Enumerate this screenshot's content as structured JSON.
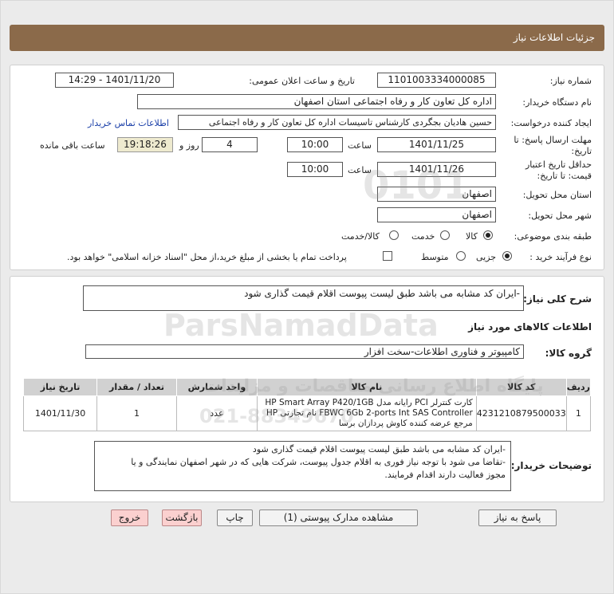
{
  "header": {
    "title": "جزئیات اطلاعات نیاز"
  },
  "form": {
    "need_number_label": "شماره نیاز:",
    "need_number": "1101003334000085",
    "announce_label": "تاریخ و ساعت اعلان عمومی:",
    "announce_value": "1401/11/20 - 14:29",
    "buyer_label": "نام دستگاه خریدار:",
    "buyer_value": "اداره کل تعاون  کار و رفاه اجتماعی استان اصفهان",
    "creator_label": "ایجاد کننده درخواست:",
    "creator_value": "حسین هادیان بجگردی کارشناس تاسیسات اداره کل تعاون  کار و رفاه اجتماعی",
    "contact_link": "اطلاعات تماس خریدار",
    "deadline_label_1": "مهلت ارسال پاسخ: تا",
    "deadline_label_2": "تاریخ:",
    "deadline_date": "1401/11/25",
    "time_label": "ساعت",
    "deadline_time": "10:00",
    "days_value": "4",
    "days_label": "روز و",
    "remaining_time": "19:18:26",
    "remaining_label": "ساعت باقی مانده",
    "validity_label_1": "حداقل تاریخ اعتبار",
    "validity_label_2": "قیمت: تا تاریخ:",
    "validity_date": "1401/11/26",
    "validity_time": "10:00",
    "province_label": "استان محل تحویل:",
    "province_value": "اصفهان",
    "city_label": "شهر محل تحویل:",
    "city_value": "اصفهان",
    "category_label": "طبقه بندی موضوعی:",
    "category_options": [
      "کالا",
      "خدمت",
      "کالا/خدمت"
    ],
    "process_label": "نوع فرآیند خرید :",
    "process_options": [
      "جزیی",
      "متوسط"
    ],
    "payment_note": "پرداخت تمام یا بخشی از مبلغ خرید،از محل \"اسناد خزانه اسلامی\" خواهد بود."
  },
  "summary": {
    "label": "شرح کلی نیاز:",
    "value": "-ایران کد مشابه می باشد طبق لیست پیوست اقلام قیمت گذاری شود"
  },
  "goods": {
    "section_title": "اطلاعات کالاهای مورد نیاز",
    "group_label": "گروه کالا:",
    "group_value": "کامپیوتر و فناوری اطلاعات-سخت افزار",
    "columns": [
      "ردیف",
      "کد کالا",
      "نام کالا",
      "واحد شمارش",
      "تعداد / مقدار",
      "تاریخ نیاز"
    ],
    "rows": [
      {
        "row": "1",
        "code": "4231210879500033",
        "name": "کارت کنترلر PCI رایانه مدل HP Smart Array P420/1GB FBWC 6Gb 2-ports Int SAS Controller نام تجارتی HP مرجع عرضه کننده کاوش پردازان برسا",
        "unit": "عدد",
        "qty": "1",
        "date": "1401/11/30"
      }
    ]
  },
  "buyer_notes": {
    "label": "توضیحات خریدار:",
    "lines": [
      "-ایران کد مشابه می باشد طبق لیست پیوست اقلام قیمت گذاری شود",
      "-تقاضا می شود با توجه نیاز فوری به اقلام جدول پیوست، شرکت هایی که در شهر اصفهان نمایندگی و یا",
      "مجوز فعالیت دارند اقدام فرمایند."
    ]
  },
  "buttons": {
    "reply": "پاسخ به نیاز",
    "attachments": "مشاهده مدارک پیوستی (1)",
    "print": "چاپ",
    "back": "بازگشت",
    "exit": "خروج"
  },
  "watermark": {
    "brand": "ParsNamadData",
    "tagline": "پایگاه اطلاع رسانی مناقصات و مزایدات",
    "phone": "021-88349670",
    "number": "0101"
  }
}
